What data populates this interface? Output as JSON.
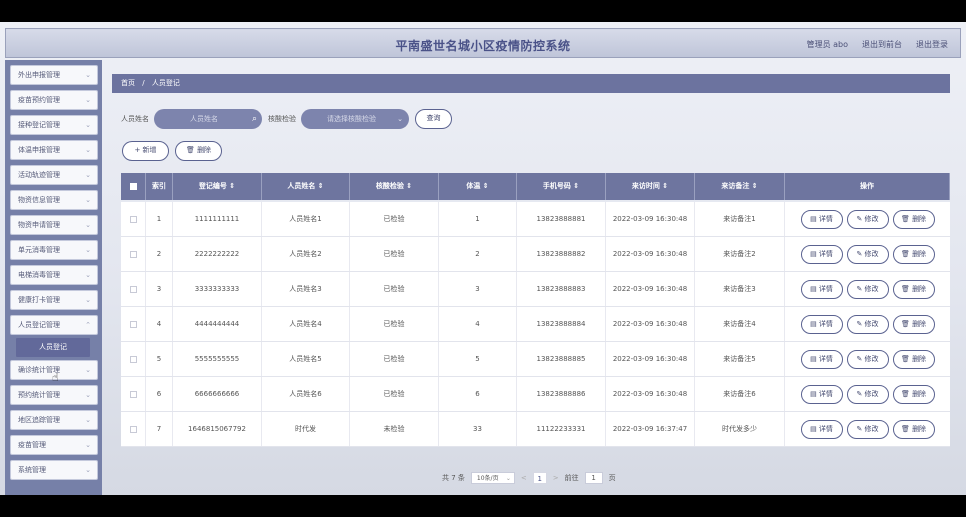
{
  "header": {
    "title": "平南盛世名城小区疫情防控系统",
    "nav": [
      "管理员 abo",
      "退出到前台",
      "退出登录"
    ]
  },
  "sidebar": {
    "items": [
      {
        "label": "外出申报管理"
      },
      {
        "label": "疫苗预约管理"
      },
      {
        "label": "接种登记管理"
      },
      {
        "label": "体温申报管理"
      },
      {
        "label": "活动轨迹管理"
      },
      {
        "label": "物资信息管理"
      },
      {
        "label": "物资申请管理"
      },
      {
        "label": "单元消毒管理"
      },
      {
        "label": "电梯消毒管理"
      },
      {
        "label": "健康打卡管理"
      },
      {
        "label": "人员登记管理"
      },
      {
        "label": "确诊统计管理"
      },
      {
        "label": "预约统计管理"
      },
      {
        "label": "地区追踪管理"
      },
      {
        "label": "疫苗管理"
      },
      {
        "label": "系统管理"
      }
    ],
    "submenu_active": "人员登记",
    "chevron": "chevron-down-icon"
  },
  "breadcrumb": {
    "home": "首页",
    "sep": "/",
    "current": "人员登记"
  },
  "search": {
    "name_label": "人员姓名",
    "name_placeholder": "人员姓名",
    "check_label": "核酸检验",
    "check_placeholder": "请选择核酸检验",
    "search_button": "查询"
  },
  "actions": {
    "add": "+ 新增",
    "delete": "删除"
  },
  "table": {
    "headers": [
      "索引",
      "登记编号 ⇕",
      "人员姓名 ⇕",
      "核酸检验 ⇕",
      "体温 ⇕",
      "手机号码 ⇕",
      "来访时间 ⇕",
      "来访备注 ⇕",
      "操作"
    ],
    "rows": [
      [
        "1",
        "1111111111",
        "人员姓名1",
        "已检验",
        "1",
        "13823888881",
        "2022-03-09 16:30:48",
        "来访备注1"
      ],
      [
        "2",
        "2222222222",
        "人员姓名2",
        "已检验",
        "2",
        "13823888882",
        "2022-03-09 16:30:48",
        "来访备注2"
      ],
      [
        "3",
        "3333333333",
        "人员姓名3",
        "已检验",
        "3",
        "13823888883",
        "2022-03-09 16:30:48",
        "来访备注3"
      ],
      [
        "4",
        "4444444444",
        "人员姓名4",
        "已检验",
        "4",
        "13823888884",
        "2022-03-09 16:30:48",
        "来访备注4"
      ],
      [
        "5",
        "5555555555",
        "人员姓名5",
        "已检验",
        "5",
        "13823888885",
        "2022-03-09 16:30:48",
        "来访备注5"
      ],
      [
        "6",
        "6666666666",
        "人员姓名6",
        "已检验",
        "6",
        "13823888886",
        "2022-03-09 16:30:48",
        "来访备注6"
      ],
      [
        "7",
        "1646815067792",
        "时代发",
        "未检验",
        "33",
        "11122233331",
        "2022-03-09 16:37:47",
        "时代发多少"
      ]
    ],
    "row_ops": {
      "detail": "详情",
      "edit": "修改",
      "delete": "删除"
    }
  },
  "pager": {
    "total": "共 7 条",
    "page_size": "10条/页",
    "prev": "<",
    "current": "1",
    "next": ">",
    "goto_label": "前往",
    "goto_value": "1",
    "page_suffix": "页"
  },
  "colors": {
    "accent": "#6e759f",
    "accent_dark": "#5a6290",
    "sidebar_bg": "#7680a8"
  }
}
